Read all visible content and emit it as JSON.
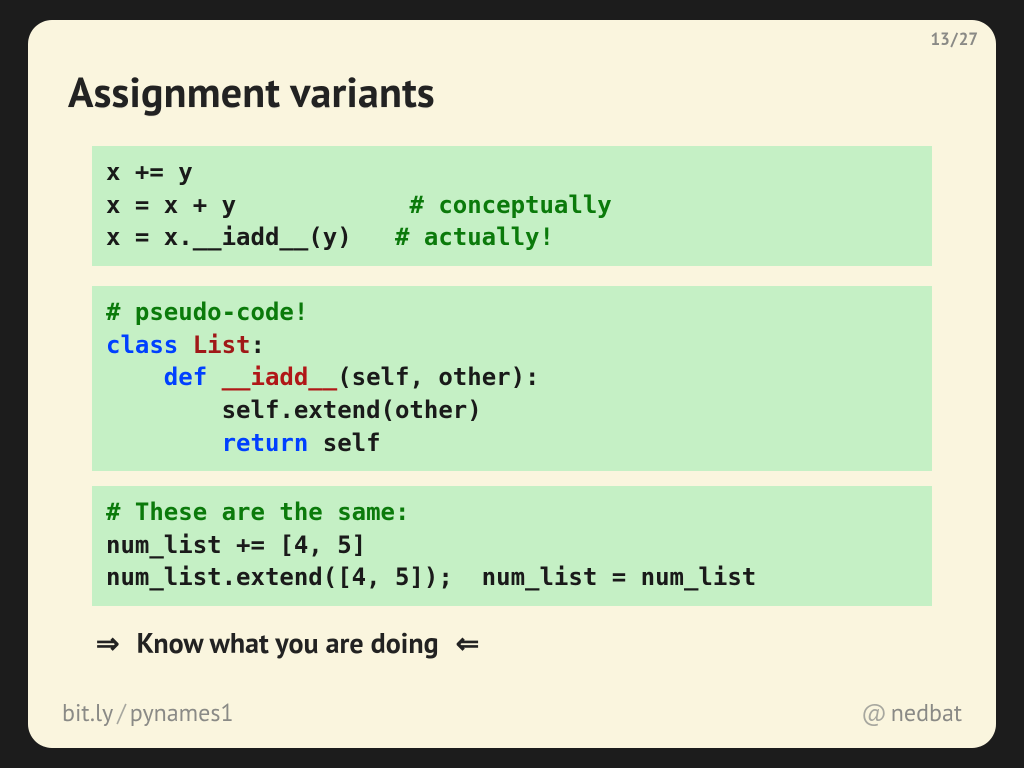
{
  "pager": {
    "current": "13",
    "total": "27",
    "sep": "/"
  },
  "title": "Assignment variants",
  "code": {
    "block_a": {
      "l1": "x += y",
      "l2a": "x = x + y            ",
      "l2b": "# conceptually",
      "l3a": "x = x.__iadd__(y)   ",
      "l3b": "# actually!"
    },
    "block_b": {
      "l1": "# pseudo-code!",
      "l2a": "class",
      "l2b": " ",
      "l2c": "List",
      "l2d": ":",
      "l3a": "    ",
      "l3b": "def",
      "l3c": " ",
      "l3d": "__iadd__",
      "l3e": "(self, other):",
      "l4": "        self.extend(other)",
      "l5a": "        ",
      "l5b": "return",
      "l5c": " self"
    },
    "block_c": {
      "l1": "# These are the same:",
      "l2": "num_list += [4, 5]",
      "l3": "num_list.extend([4, 5]);  num_list = num_list"
    }
  },
  "callout": {
    "left_arrow": "⇒",
    "text": "Know what you are doing",
    "right_arrow": "⇐"
  },
  "footer": {
    "url_host": "bit.ly",
    "url_sep": "/",
    "url_path": "pynames1",
    "handle_at": "@",
    "handle": "nedbat"
  }
}
